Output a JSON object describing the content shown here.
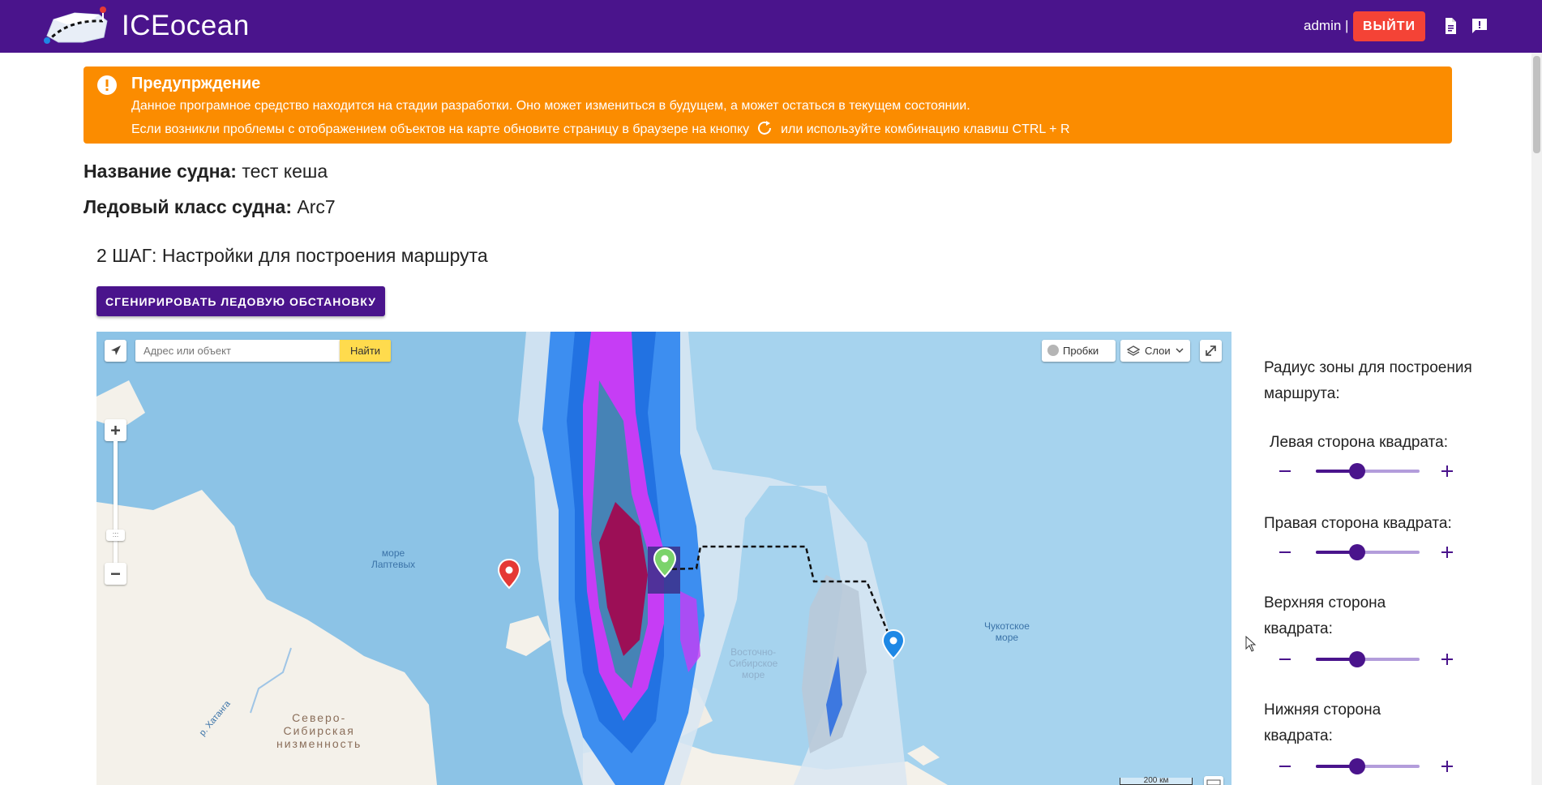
{
  "header": {
    "brand": "ICEocean",
    "user": "admin |",
    "logout_label": "ВЫЙТИ"
  },
  "warning": {
    "title": "Предупрждение",
    "line1": "Данное програмное средство находится на стадии разработки. Оно может измениться в будущем, а может остаться в текущем состоянии.",
    "line2_before": "Если возникли проблемы с отображением объектов на карте обновите страницу в браузере на кнопку",
    "line2_after": "или используйте комбинацию клавиш CTRL + R"
  },
  "vessel": {
    "name_label": "Название судна:",
    "name_value": "тест кеша",
    "class_label": "Ледовый класс судна:",
    "class_value": "Arc7"
  },
  "step": {
    "title": "2 ШАГ: Настройки для построения маршрута",
    "generate_label": "СГЕНИРИРОВАТЬ ЛЕДОВУЮ ОБСТАНОВКУ"
  },
  "map": {
    "search_placeholder": "Адрес или объект",
    "search_button": "Найти",
    "traffic_label": "Пробки",
    "layers_label": "Слои",
    "scale_label": "200 км",
    "labels": {
      "laptev": "море\nЛаптевых",
      "east_siberian": "Восточно-\nСибирское\nморе",
      "chukchi": "Чукотское\nморе",
      "lowland": "Северо-\nСибирская\nнизменность",
      "khatanga": "р. Хатанга"
    }
  },
  "panel": {
    "title": "Радиус зоны для построения маршрута:",
    "sliders": [
      {
        "label": "Левая сторона квадрата:",
        "value": 0.4
      },
      {
        "label": "Правая сторона квадрата:",
        "value": 0.4
      },
      {
        "label": "Верхняя сторона квадрата:",
        "value": 0.4
      },
      {
        "label": "Нижняя сторона квадрата:",
        "value": 0.4
      }
    ]
  },
  "colors": {
    "header": "#4a148c",
    "warning": "#fb8c00",
    "logout": "#f44336",
    "search_button": "#ffdb4d"
  }
}
